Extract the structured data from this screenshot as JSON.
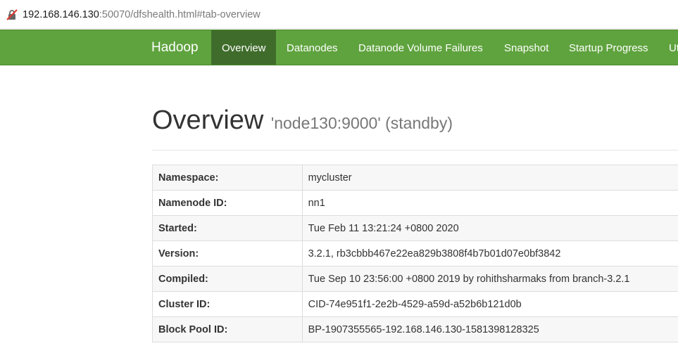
{
  "browser": {
    "url_host": "192.168.146.130",
    "url_rest": ":50070/dfshealth.html#tab-overview",
    "security_icon": "not-secure-icon"
  },
  "navbar": {
    "brand": "Hadoop",
    "items": [
      {
        "label": "Overview",
        "active": true
      },
      {
        "label": "Datanodes"
      },
      {
        "label": "Datanode Volume Failures"
      },
      {
        "label": "Snapshot"
      },
      {
        "label": "Startup Progress"
      },
      {
        "label": "Ut"
      }
    ],
    "color": "#5fa33e",
    "active_color": "#3f6c2b"
  },
  "page": {
    "title": "Overview",
    "subtitle": "'node130:9000' (standby)"
  },
  "overview": {
    "rows": [
      {
        "key": "Namespace:",
        "value": "mycluster"
      },
      {
        "key": "Namenode ID:",
        "value": "nn1"
      },
      {
        "key": "Started:",
        "value": "Tue Feb 11 13:21:24 +0800 2020"
      },
      {
        "key": "Version:",
        "value": "3.2.1, rb3cbbb467e22ea829b3808f4b7b01d07e0bf3842"
      },
      {
        "key": "Compiled:",
        "value": "Tue Sep 10 23:56:00 +0800 2019 by rohithsharmaks from branch-3.2.1"
      },
      {
        "key": "Cluster ID:",
        "value": "CID-74e951f1-2e2b-4529-a59d-a52b6b121d0b"
      },
      {
        "key": "Block Pool ID:",
        "value": "BP-1907355565-192.168.146.130-1581398128325"
      }
    ]
  }
}
